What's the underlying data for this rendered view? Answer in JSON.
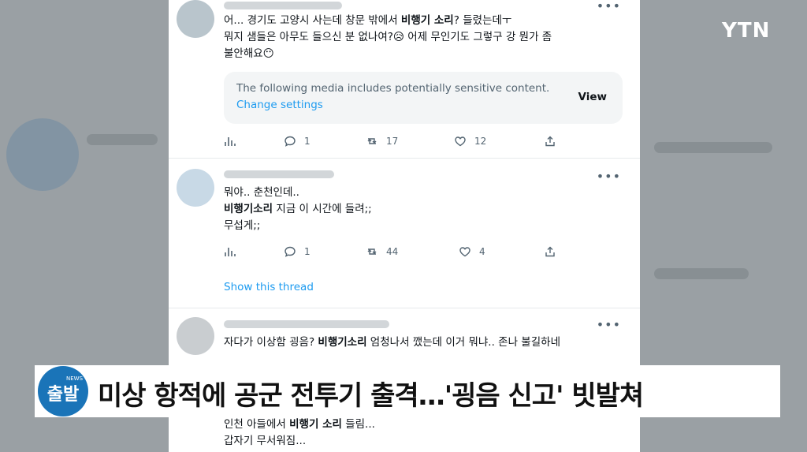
{
  "broadcaster_logo": "YTN",
  "tweets": [
    {
      "text_html": "어... 경기도 고양시 사는데 창문 밖에서 <b>비행기 소리</b>? 들렸는데ㅜ\n뭐지 샘들은 아무도 들으신 분 없나여?😥 어제 무인기도 그렇구 강 뭔가 좀\n불안해요😶",
      "media_notice": "The following media includes potentially sensitive content.",
      "change_settings": "Change settings",
      "view": "View",
      "stats": {
        "replies": "1",
        "retweets": "17",
        "likes": "12"
      }
    },
    {
      "text_html": "뭐야.. 춘천인데..\n<b>비행기소리</b> 지금 이 시간에 들려;;\n무섭게;;",
      "stats": {
        "replies": "1",
        "retweets": "44",
        "likes": "4"
      },
      "show_thread": "Show this thread"
    },
    {
      "text_html": "자다가 이상함 굉음? <b>비행기소리</b> 엄청나서 깼는데 이거 뭐냐.. 존나 불길하네"
    }
  ],
  "below_caption_text_html": "인천 아들에서 <b>비행기 소리</b> 들림...\n갑자기 무서워짐...",
  "caption": {
    "badge_small": "NEWS",
    "badge_word": "출발",
    "headline": "미상 항적에 공군 전투기 출격…'굉음 신고' 빗발쳐"
  },
  "icons": [
    "analytics-icon",
    "reply-icon",
    "retweet-icon",
    "like-icon",
    "share-icon",
    "more-icon"
  ],
  "colors": {
    "link": "#1d9bf0",
    "badge": "#1a74b8",
    "muted": "#536471"
  }
}
